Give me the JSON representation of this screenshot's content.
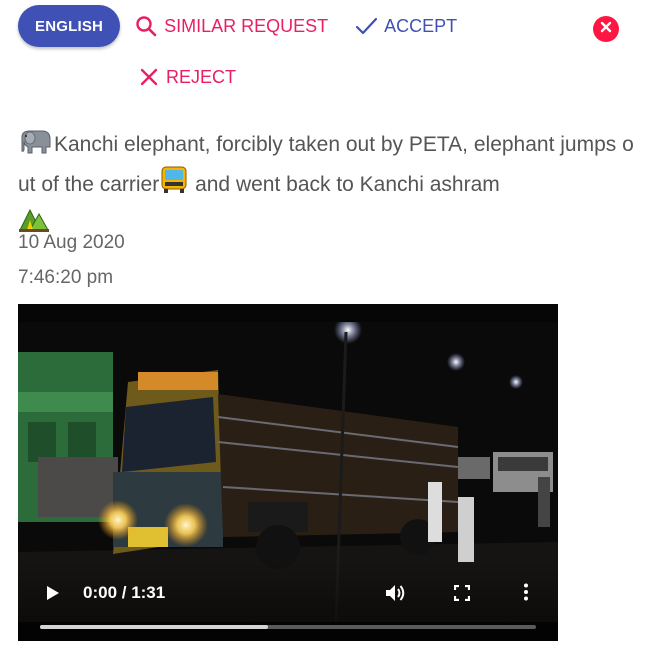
{
  "toolbar": {
    "language_label": "ENGLISH",
    "similar_label": "SIMILAR REQUEST",
    "accept_label": "ACCEPT",
    "reject_label": "REJECT"
  },
  "post": {
    "text_part1": "Kanchi elephant, forcibly taken out by PETA, elephant jumps out of the carrier",
    "text_part2": " and went back to Kanchi ashram",
    "emojis": [
      "elephant-icon",
      "bus-icon",
      "mountain-icon"
    ],
    "date": "10 Aug 2020",
    "time": "7:46:20 pm"
  },
  "video": {
    "time_display": "0:00 / 1:31",
    "progress_buffered": 0.46
  },
  "colors": {
    "primary": "#3f51b5",
    "accent": "#e91e63",
    "close": "#ff1744"
  }
}
